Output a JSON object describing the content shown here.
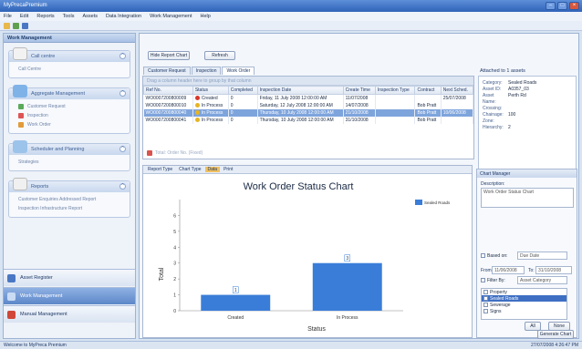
{
  "window": {
    "title": "MyPrecaPremium"
  },
  "menu": [
    "File",
    "Edit",
    "Reports",
    "Tools",
    "Assets",
    "Data Integration",
    "Work Management",
    "Help"
  ],
  "sidebar": {
    "header": "Work Management",
    "groups": [
      {
        "title": "Call centre",
        "items": [
          "Call Centre"
        ]
      },
      {
        "title": "Aggregate Management",
        "items": [
          "Customer Request",
          "Inspection",
          "Work Order"
        ]
      },
      {
        "title": "Scheduler and Planning",
        "items": [
          "Strategies"
        ]
      },
      {
        "title": "Reports",
        "items": [
          "Customer Enquiries Addressed Report",
          "Inspection Infrastructure Report"
        ]
      }
    ],
    "nav": [
      "Asset Register",
      "Work Management",
      "Manual Management"
    ]
  },
  "main": {
    "hide_report_chart": "Hide Report Chart",
    "refresh": "Refresh",
    "tabs": [
      "Customer Request",
      "Inspection",
      "Work Order"
    ],
    "active_tab": 2,
    "group_hint": "Drag a column header here to group by that column",
    "columns": [
      "Ref No.",
      "Status",
      "Completed",
      "Inspection Date",
      "Create Time",
      "Inspection Type",
      "Contract",
      "Next Sched."
    ],
    "rows": [
      {
        "ref": "WO0007200800009",
        "status": "Created",
        "status_color": "#d9362b",
        "completed": "0",
        "date": "Friday, 11 July 2008 12:00:00 AM",
        "create": "11/07/2008",
        "type": "",
        "contract": "",
        "next": "25/07/2008"
      },
      {
        "ref": "WO0007200800010",
        "status": "In Process",
        "status_color": "#e6b422",
        "completed": "0",
        "date": "Saturday, 12 July 2008 12:00:00 AM",
        "create": "14/07/2008",
        "type": "",
        "contract": "Bob Pratt",
        "next": ""
      },
      {
        "ref": "WO0007200800040",
        "status": "In Process",
        "status_color": "#e6b422",
        "completed": "0",
        "date": "Thursday, 10 July 2008 12:00:00 AM",
        "create": "21/10/2008",
        "type": "",
        "contract": "Bob Pratt",
        "next": "10/06/2008"
      },
      {
        "ref": "WO0007200800041",
        "status": "In Process",
        "status_color": "#e6b422",
        "completed": "0",
        "date": "Thursday, 10 July 2008 12:00:00 AM",
        "create": "31/10/2008",
        "type": "",
        "contract": "Bob Pratt",
        "next": ""
      }
    ],
    "selected_row": 2,
    "footer": "Total: Order No. (Fixed)"
  },
  "attached": {
    "title": "Attached to 1 assets",
    "fields": [
      {
        "k": "Category:",
        "v": "Sealed Roads"
      },
      {
        "k": "Asset ID:",
        "v": "A0357_03"
      },
      {
        "k": "Asset Name:",
        "v": "Perth Rd"
      },
      {
        "k": "Crossing:",
        "v": ""
      },
      {
        "k": "Chainage:",
        "v": "100"
      },
      {
        "k": "Zone:",
        "v": ""
      },
      {
        "k": "Hierarchy:",
        "v": "2"
      }
    ]
  },
  "chart_tabs": [
    "Report Type",
    "Chart Type",
    "Data",
    "Print"
  ],
  "chart_data": {
    "type": "bar",
    "title": "Work Order Status Chart",
    "xlabel": "Status",
    "ylabel": "Total",
    "categories": [
      "Created",
      "In Process"
    ],
    "series": [
      {
        "name": "Sealed Roads",
        "values": [
          1,
          3
        ],
        "color": "#3a7dd8"
      }
    ],
    "ylim": [
      0,
      7
    ],
    "yticks": [
      "0",
      "1",
      "2",
      "3",
      "4",
      "5",
      "6"
    ],
    "data_labels": [
      "1",
      "3"
    ]
  },
  "chart_setup": {
    "title": "Chart Manager",
    "desc_label": "Description:",
    "desc_value": "Work Order Status Chart",
    "based_on_label": "Based on:",
    "based_on_value": "Due Date",
    "from_label": "From:",
    "from_value": "11/06/2008",
    "to_label": "To:",
    "to_value": "31/10/2008",
    "filter_label": "Filter By:",
    "filter_value": "Asset Category",
    "list": [
      "Property",
      "Sealed Roads",
      "Sewerage",
      "Signs"
    ],
    "list_selected": 1,
    "all_btn": "All",
    "none_btn": "None",
    "generate_btn": "Generate Chart"
  },
  "statusbar": {
    "left": "Welcome to MyPreca Premium",
    "right": "27/07/2008 4:26:47 PM"
  },
  "colors": {
    "accent": "#3a7dd8",
    "selection": "#7ea4dc",
    "title_bar": "#2f63b8"
  }
}
